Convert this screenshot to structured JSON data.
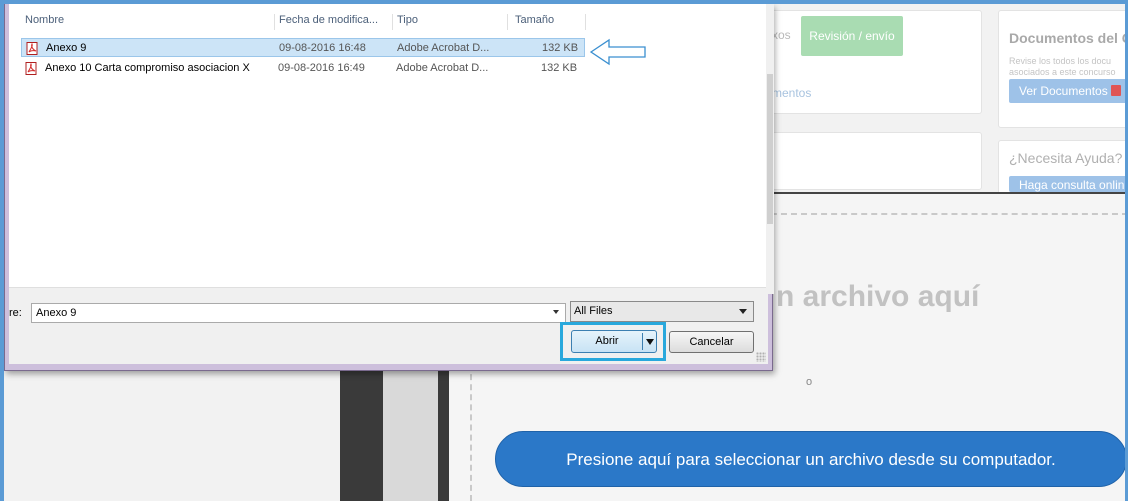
{
  "dialog": {
    "columns": [
      "Nombre",
      "Fecha de modifica...",
      "Tipo",
      "Tamaño"
    ],
    "files": [
      {
        "name": "Anexo 9",
        "date": "09-08-2016 16:48",
        "type": "Adobe Acrobat D...",
        "size": "132 KB",
        "selected": true
      },
      {
        "name": "Anexo 10 Carta compromiso asociacion X",
        "date": "09-08-2016 16:49",
        "type": "Adobe Acrobat D...",
        "size": "132 KB",
        "selected": false
      }
    ],
    "filename_label": "re:",
    "filename_value": "Anexo 9",
    "filter_value": "All Files",
    "open_label": "Abrir",
    "cancel_label": "Cancelar"
  },
  "background": {
    "tab_faded": "xos",
    "tab_revision": "Revisión / envío",
    "tab_docs_faded": "mentos",
    "side_docs_title": "Documentos del Co",
    "side_docs_text_1": "Revise los todos los docu",
    "side_docs_text_2": "asociados a este concurso",
    "side_docs_button": "Ver Documentos",
    "side_help_title": "¿Necesita Ayuda?",
    "side_help_button": "Haga consulta onlin",
    "drop_text": "n archivo aquí",
    "drop_or": "o",
    "upload_button": "Presione aquí para seleccionar un archivo desde su computador."
  },
  "colors": {
    "accent": "#5b9bd5",
    "highlight": "#29a8dc",
    "upload_button": "#2b78c8",
    "revision_tab": "#a9dcb2"
  },
  "icons": {
    "file_icon": "pdf-file-icon",
    "hint": "arrow-left-outline-icon"
  }
}
